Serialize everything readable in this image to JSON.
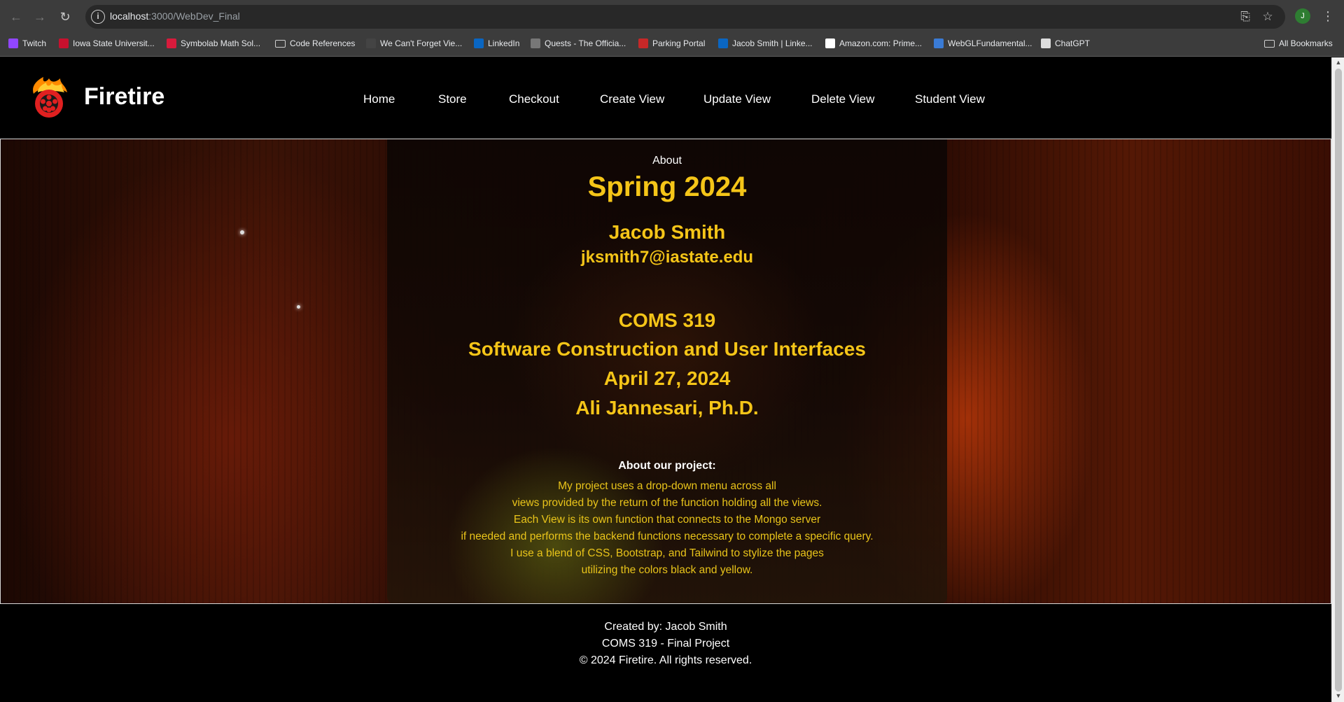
{
  "browser": {
    "url_host": "localhost",
    "url_rest": ":3000/WebDev_Final",
    "bookmarks": [
      {
        "label": "Twitch",
        "icon": "twitch-icon",
        "color": "#9146ff"
      },
      {
        "label": "Iowa State Universit...",
        "icon": "isu-icon",
        "color": "#c8102e"
      },
      {
        "label": "Symbolab Math Sol...",
        "icon": "symbolab-icon",
        "color": "#d81b3c"
      },
      {
        "label": "Code References",
        "icon": "folder-icon",
        "color": "#d0d0d0"
      },
      {
        "label": "We Can't Forget Vie...",
        "icon": "site-icon",
        "color": "#444444"
      },
      {
        "label": "LinkedIn",
        "icon": "linkedin-icon",
        "color": "#0a66c2"
      },
      {
        "label": "Quests - The Officia...",
        "icon": "quests-icon",
        "color": "#777777"
      },
      {
        "label": "Parking Portal",
        "icon": "parking-icon",
        "color": "#c62828"
      },
      {
        "label": "Jacob Smith | Linke...",
        "icon": "linkedin-icon",
        "color": "#0a66c2"
      },
      {
        "label": "Amazon.com: Prime...",
        "icon": "amazon-icon",
        "color": "#ffffff"
      },
      {
        "label": "WebGLFundamental...",
        "icon": "webgl-icon",
        "color": "#3a7bd5"
      },
      {
        "label": "ChatGPT",
        "icon": "chatgpt-icon",
        "color": "#dddddd"
      }
    ],
    "all_bookmarks": "All Bookmarks",
    "profile_initial": "J"
  },
  "site": {
    "brand": "Firetire",
    "nav": [
      "Home",
      "Store",
      "Checkout",
      "Create View",
      "Update View",
      "Delete View",
      "Student View"
    ]
  },
  "about": {
    "label": "About",
    "term": "Spring 2024",
    "name": "Jacob Smith",
    "email": "jksmith7@iastate.edu",
    "course": "COMS 319",
    "course_title": "Software Construction and User Interfaces",
    "date": "April 27, 2024",
    "instructor": "Ali Jannesari, Ph.D.",
    "project_title": "About our project:",
    "project_lines": [
      "My project uses a drop-down menu across all",
      "views provided by the return of the function holding all the views.",
      "Each View is its own function that connects to the Mongo server",
      "if needed and performs the backend functions necessary to complete a specific query.",
      "I use a blend of CSS, Bootstrap, and Tailwind to stylize the pages",
      "utilizing the colors black and yellow."
    ]
  },
  "footer": {
    "created_by": "Created by: Jacob Smith",
    "project": "COMS 319 - Final Project",
    "copyright": "© 2024 Firetire. All rights reserved."
  },
  "colors": {
    "accent": "#f5c518",
    "background": "#000000"
  }
}
